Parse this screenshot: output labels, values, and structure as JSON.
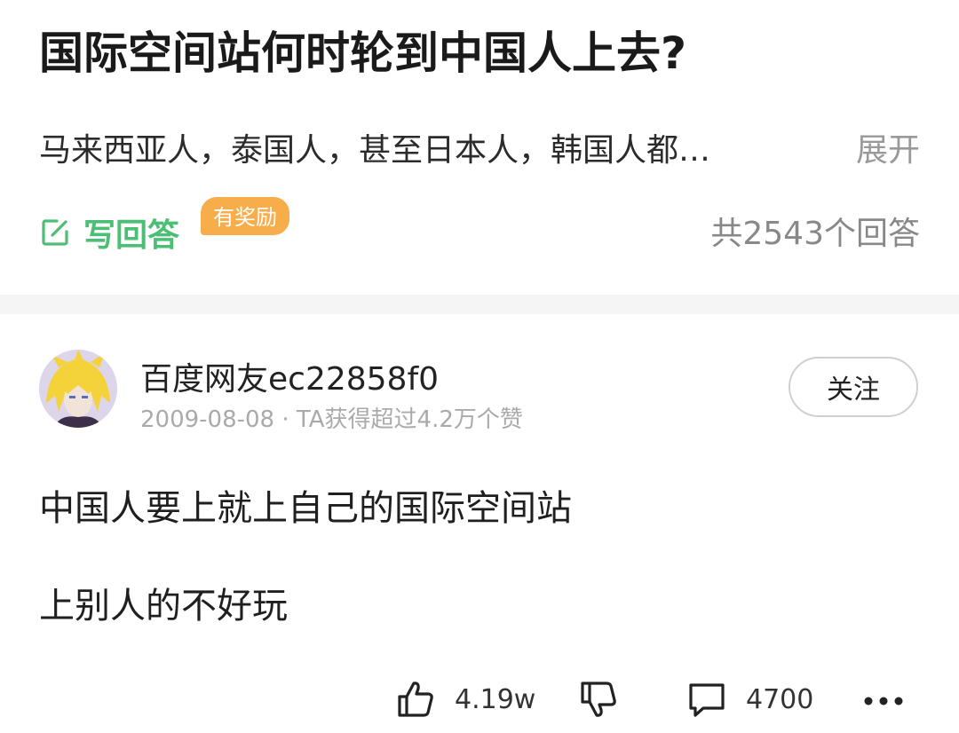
{
  "question": {
    "title": "国际空间站何时轮到中国人上去?",
    "description": "马来西亚人，泰国人，甚至日本人，韩国人都…",
    "expand_label": "展开",
    "write_answer_label": "写回答",
    "reward_badge": "有奖励",
    "answer_count": "共2543个回答"
  },
  "answer": {
    "author_name": "百度网友ec22858f0",
    "date": "2009-08-08",
    "meta_separator": "·",
    "likes_summary": "TA获得超过4.2万个赞",
    "follow_label": "关注",
    "content_lines": [
      "中国人要上就上自己的国际空间站",
      "上别人的不好玩"
    ],
    "actions": {
      "like_count": "4.19w",
      "comment_count": "4700"
    }
  },
  "icons": {
    "write": "edit-icon",
    "like": "thumbs-up-icon",
    "dislike": "thumbs-down-icon",
    "comment": "comment-icon",
    "more": "more-icon"
  },
  "colors": {
    "accent_green": "#4cbf74",
    "reward_orange": "#f7ad4a",
    "muted_gray": "#999999"
  }
}
